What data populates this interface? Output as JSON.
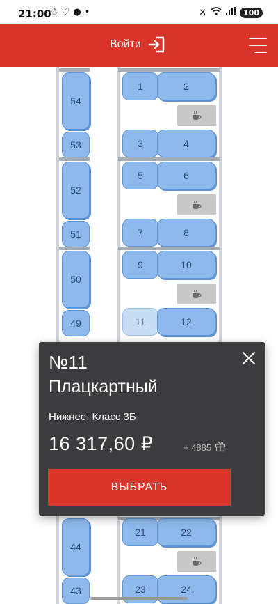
{
  "status_bar": {
    "time": "21:00",
    "left_icons": [
      "notification-icon",
      "heart-icon",
      "chat-icon",
      "dot-icon"
    ],
    "right_icons": [
      "mute-icon",
      "wifi-icon",
      "signal-icon"
    ],
    "battery": "100"
  },
  "header": {
    "login_label": "Войти",
    "accent_color": "#d9352b"
  },
  "car": {
    "compartments": [
      {
        "side_upper": "54",
        "side_lower": "53",
        "seats": [
          "1",
          "2",
          "3",
          "4"
        ]
      },
      {
        "side_upper": "52",
        "side_lower": "51",
        "seats": [
          "5",
          "6",
          "7",
          "8"
        ]
      },
      {
        "side_upper": "50",
        "side_lower": "49",
        "seats": [
          "9",
          "10",
          "11",
          "12"
        ]
      }
    ],
    "lower_seats": [
      "21",
      "22",
      "23",
      "24"
    ],
    "lower_side": [
      "44",
      "43"
    ],
    "selected_seat": "11",
    "seat_color": "#8db9ec"
  },
  "popup": {
    "seat_number": "№11",
    "car_type": "Плацкартный",
    "description": "Нижнее, Класс 3Б",
    "price": "16 317,60 ₽",
    "bonus": "+ 4885",
    "select_label": "ВЫБРАТЬ"
  }
}
